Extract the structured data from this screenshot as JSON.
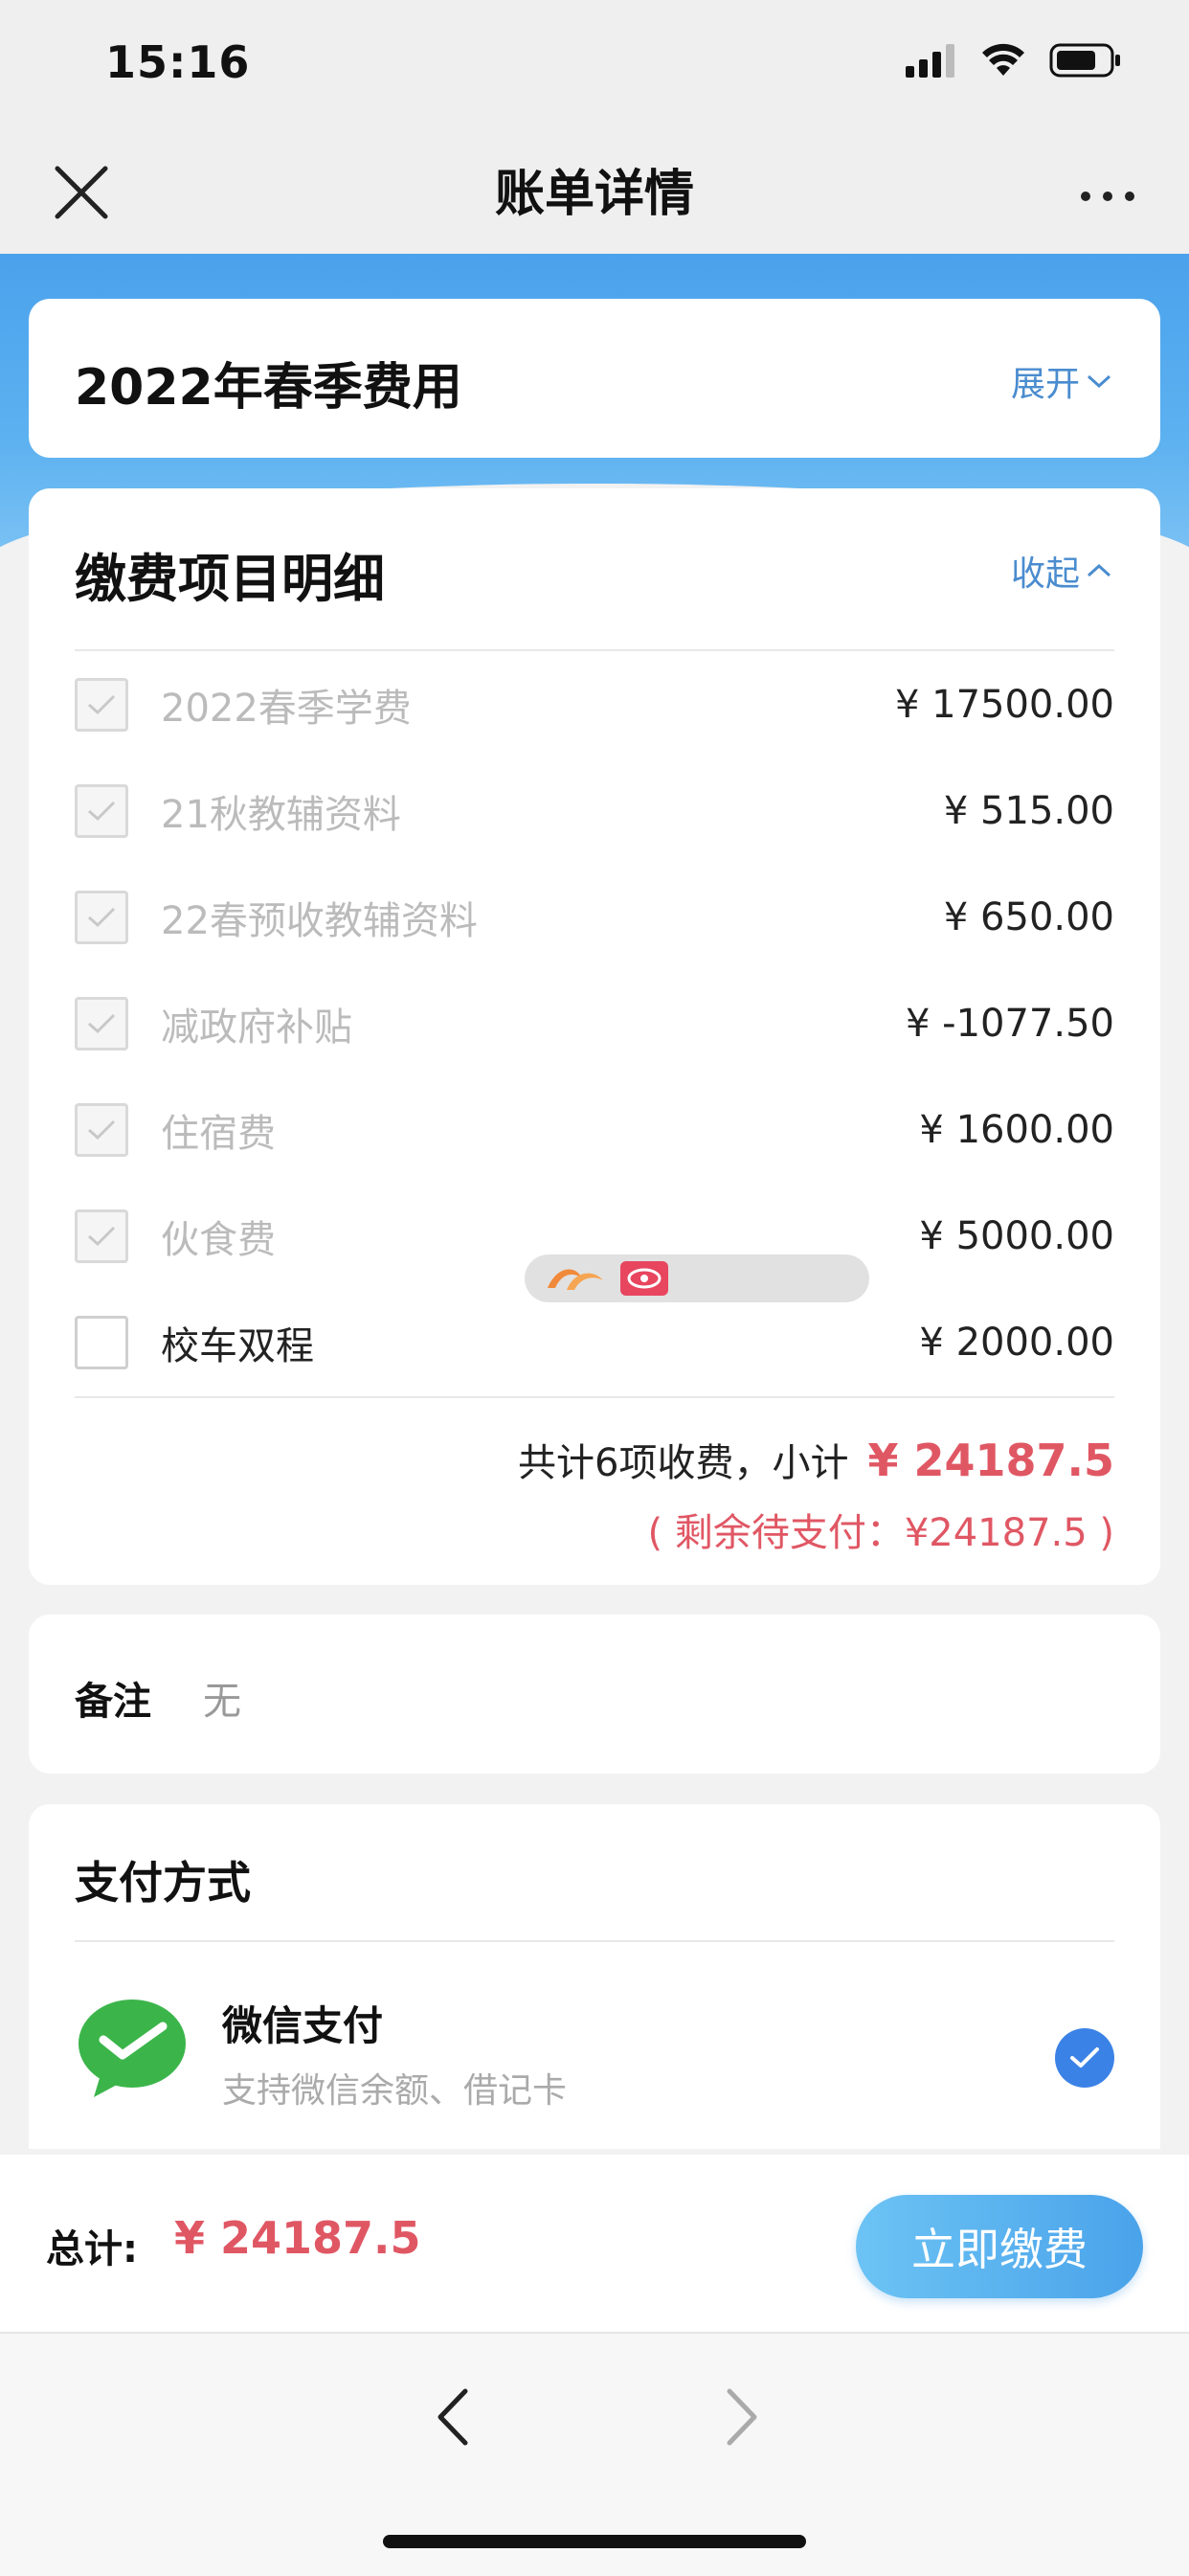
{
  "status": {
    "time": "15:16"
  },
  "nav": {
    "title": "账单详情"
  },
  "season_card": {
    "title": "2022年春季费用",
    "toggle": "展开"
  },
  "fee_card": {
    "title": "缴费项目明细",
    "toggle": "收起",
    "items": [
      {
        "name": "2022春季学费",
        "amount": "¥ 17500.00",
        "checked": true
      },
      {
        "name": "21秋教辅资料",
        "amount": "¥ 515.00",
        "checked": true
      },
      {
        "name": "22春预收教辅资料",
        "amount": "¥ 650.00",
        "checked": true
      },
      {
        "name": "减政府补贴",
        "amount": "¥ -1077.50",
        "checked": true
      },
      {
        "name": "住宿费",
        "amount": "¥ 1600.00",
        "checked": true
      },
      {
        "name": "伙食费",
        "amount": "¥ 5000.00",
        "checked": true
      },
      {
        "name": "校车双程",
        "amount": "¥ 2000.00",
        "checked": false
      }
    ],
    "subtotal_label": "共计6项收费，小计",
    "subtotal_amount": "¥ 24187.5",
    "remaining": "( 剩余待支付：¥24187.5 )"
  },
  "remark": {
    "label": "备注",
    "value": "无"
  },
  "payment": {
    "title": "支付方式",
    "method_name": "微信支付",
    "method_desc": "支持微信余额、借记卡"
  },
  "bottom": {
    "total_label": "总计:",
    "total_amount": "¥ 24187.5",
    "pay_button": "立即缴费"
  },
  "colors": {
    "accent_blue": "#4a8ccf",
    "price_red": "#e05764",
    "check_blue": "#3b82e6",
    "wechat_green": "#3bb54a"
  }
}
